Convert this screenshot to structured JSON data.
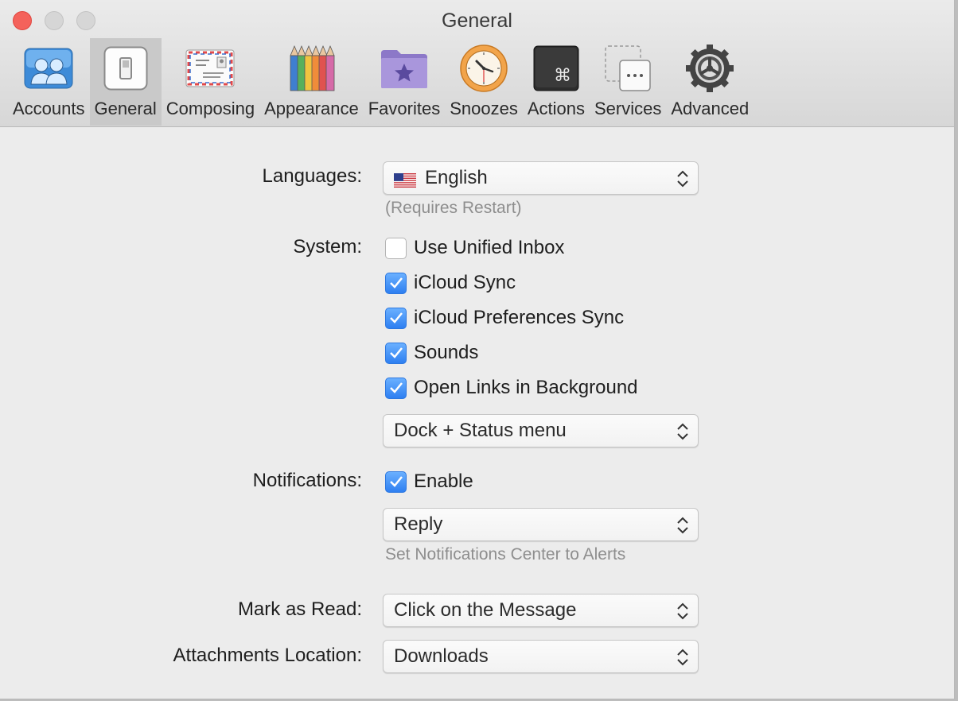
{
  "window": {
    "title": "General"
  },
  "toolbar": {
    "items": [
      {
        "label": "Accounts",
        "icon": "accounts-icon"
      },
      {
        "label": "General",
        "icon": "general-switch-icon",
        "selected": true
      },
      {
        "label": "Composing",
        "icon": "envelope-icon"
      },
      {
        "label": "Appearance",
        "icon": "colored-pencils-icon"
      },
      {
        "label": "Favorites",
        "icon": "star-folder-icon"
      },
      {
        "label": "Snoozes",
        "icon": "clock-icon"
      },
      {
        "label": "Actions",
        "icon": "command-key-icon"
      },
      {
        "label": "Services",
        "icon": "services-icon"
      },
      {
        "label": "Advanced",
        "icon": "gear-icon"
      }
    ]
  },
  "languages": {
    "label": "Languages:",
    "value": "English",
    "hint": "(Requires Restart)",
    "flag": "us-flag-icon"
  },
  "system": {
    "label": "System:",
    "options": [
      {
        "label": "Use Unified Inbox",
        "checked": false
      },
      {
        "label": "iCloud Sync",
        "checked": true
      },
      {
        "label": "iCloud Preferences Sync",
        "checked": true
      },
      {
        "label": "Sounds",
        "checked": true
      },
      {
        "label": "Open Links in Background",
        "checked": true
      }
    ],
    "dock_value": "Dock + Status menu"
  },
  "notifications": {
    "label": "Notifications:",
    "enable_label": "Enable",
    "enable_checked": true,
    "action_value": "Reply",
    "hint": "Set Notifications Center to Alerts"
  },
  "mark_as_read": {
    "label": "Mark as Read:",
    "value": "Click on the Message"
  },
  "attachments": {
    "label": "Attachments Location:",
    "value": "Downloads"
  },
  "colors": {
    "accent": "#3b8cf6",
    "close": "#f4625b",
    "selected_tab": "#c9c9c9"
  }
}
